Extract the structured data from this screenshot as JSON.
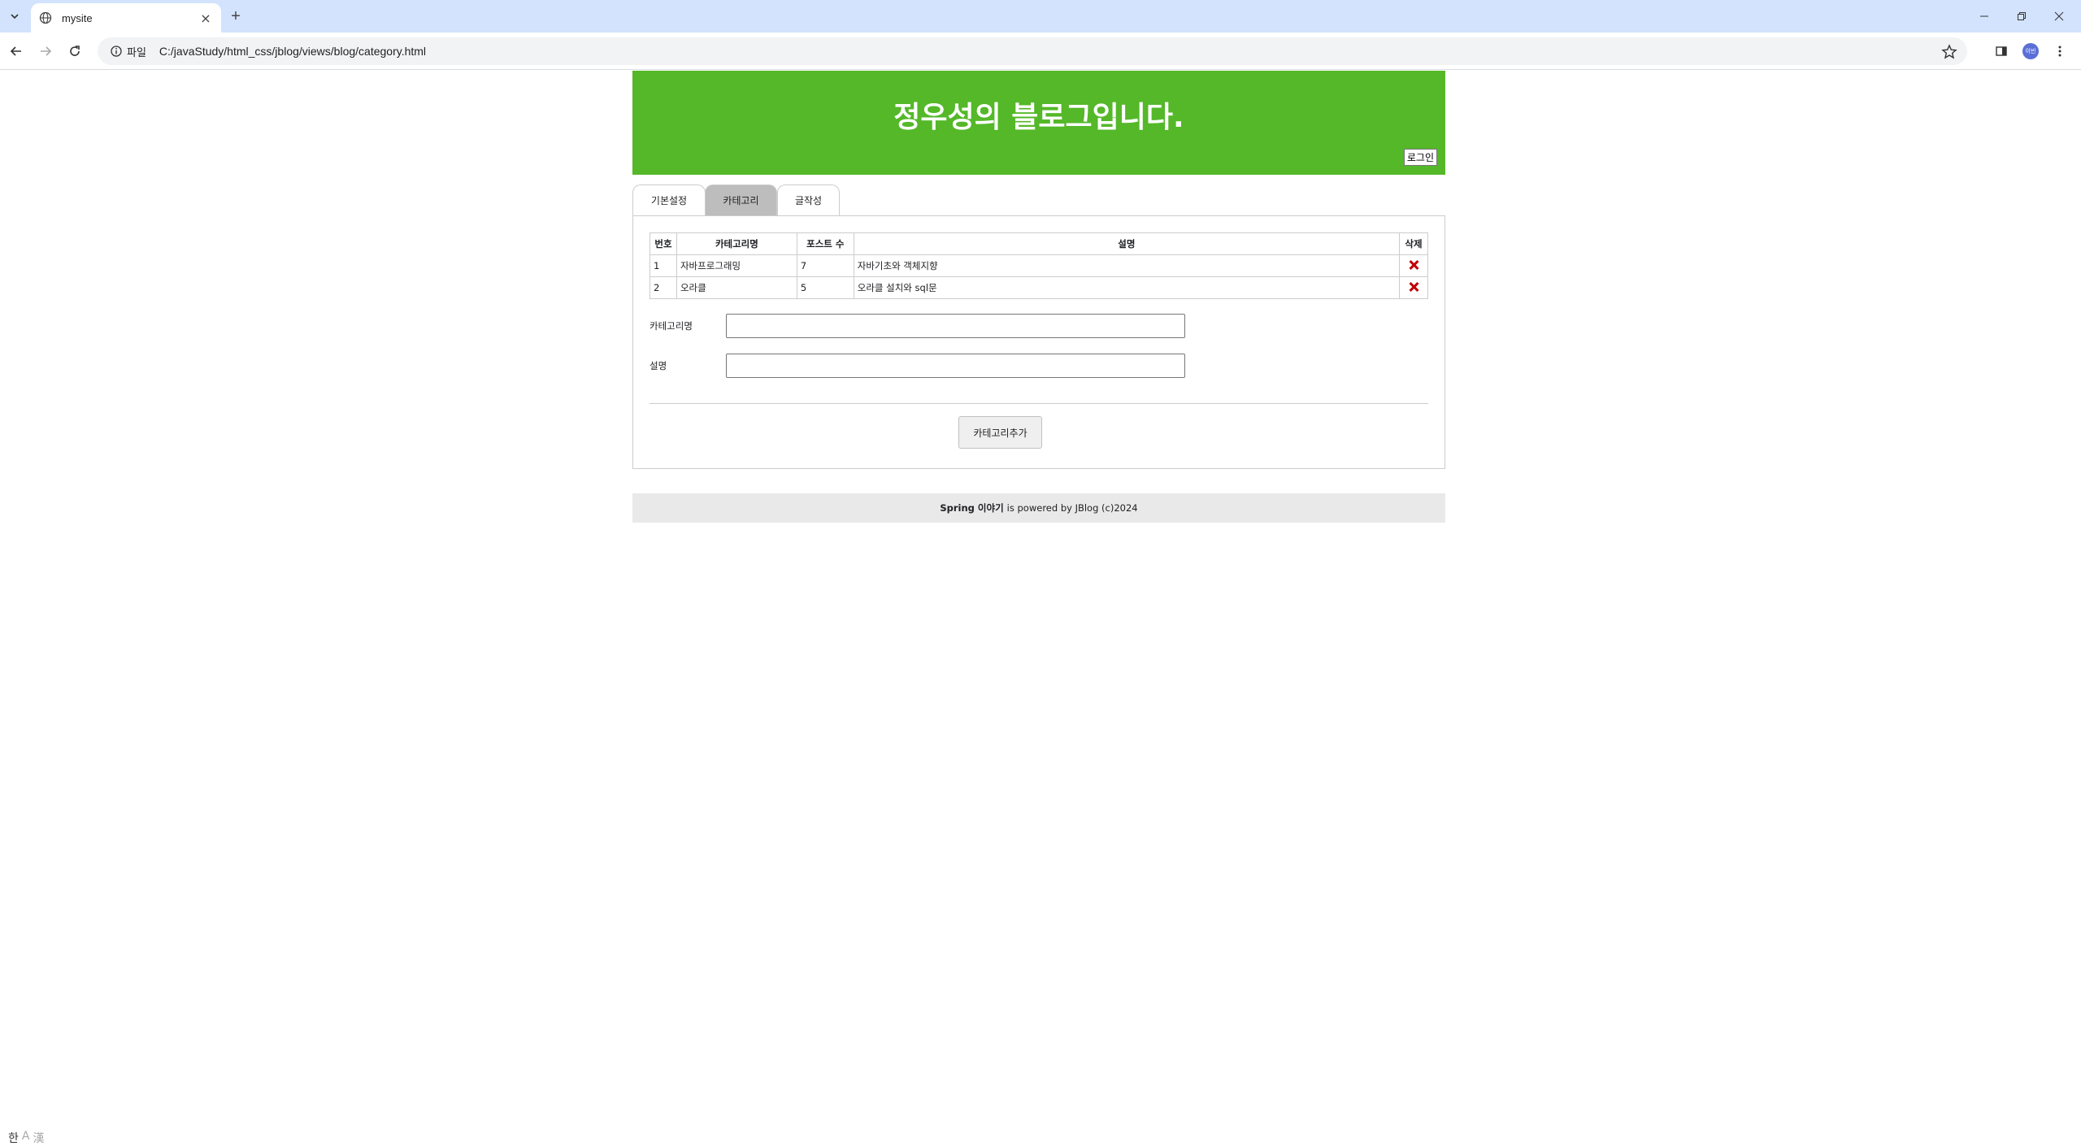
{
  "browser": {
    "tab_title": "mysite",
    "address_chip": "파일",
    "url": "C:/javaStudy/html_css/jblog/views/blog/category.html",
    "profile_initials": "이빈"
  },
  "blog": {
    "title": "정우성의 블로그입니다.",
    "login": "로그인",
    "header_color": "#54b828"
  },
  "tabs": [
    {
      "label": "기본설정",
      "active": false
    },
    {
      "label": "카테고리",
      "active": true
    },
    {
      "label": "글작성",
      "active": false
    }
  ],
  "category_table": {
    "headers": [
      "번호",
      "카테고리명",
      "포스트 수",
      "설명",
      "삭제"
    ],
    "rows": [
      {
        "no": "1",
        "name": "자바프로그래밍",
        "posts": "7",
        "desc": "자바기초와 객체지향"
      },
      {
        "no": "2",
        "name": "오라클",
        "posts": "5",
        "desc": "오라클 설치와 sql문"
      }
    ],
    "delete_icon": "delete-x-icon"
  },
  "form": {
    "name_label": "카테고리명",
    "name_value": "",
    "desc_label": "설명",
    "desc_value": "",
    "submit": "카테고리추가"
  },
  "footer": {
    "brand": "Spring 이야기",
    "text": "is powered by JBlog (c)2024"
  },
  "ime": {
    "mode1": "한",
    "mode2": "A",
    "mode3": "漢"
  }
}
